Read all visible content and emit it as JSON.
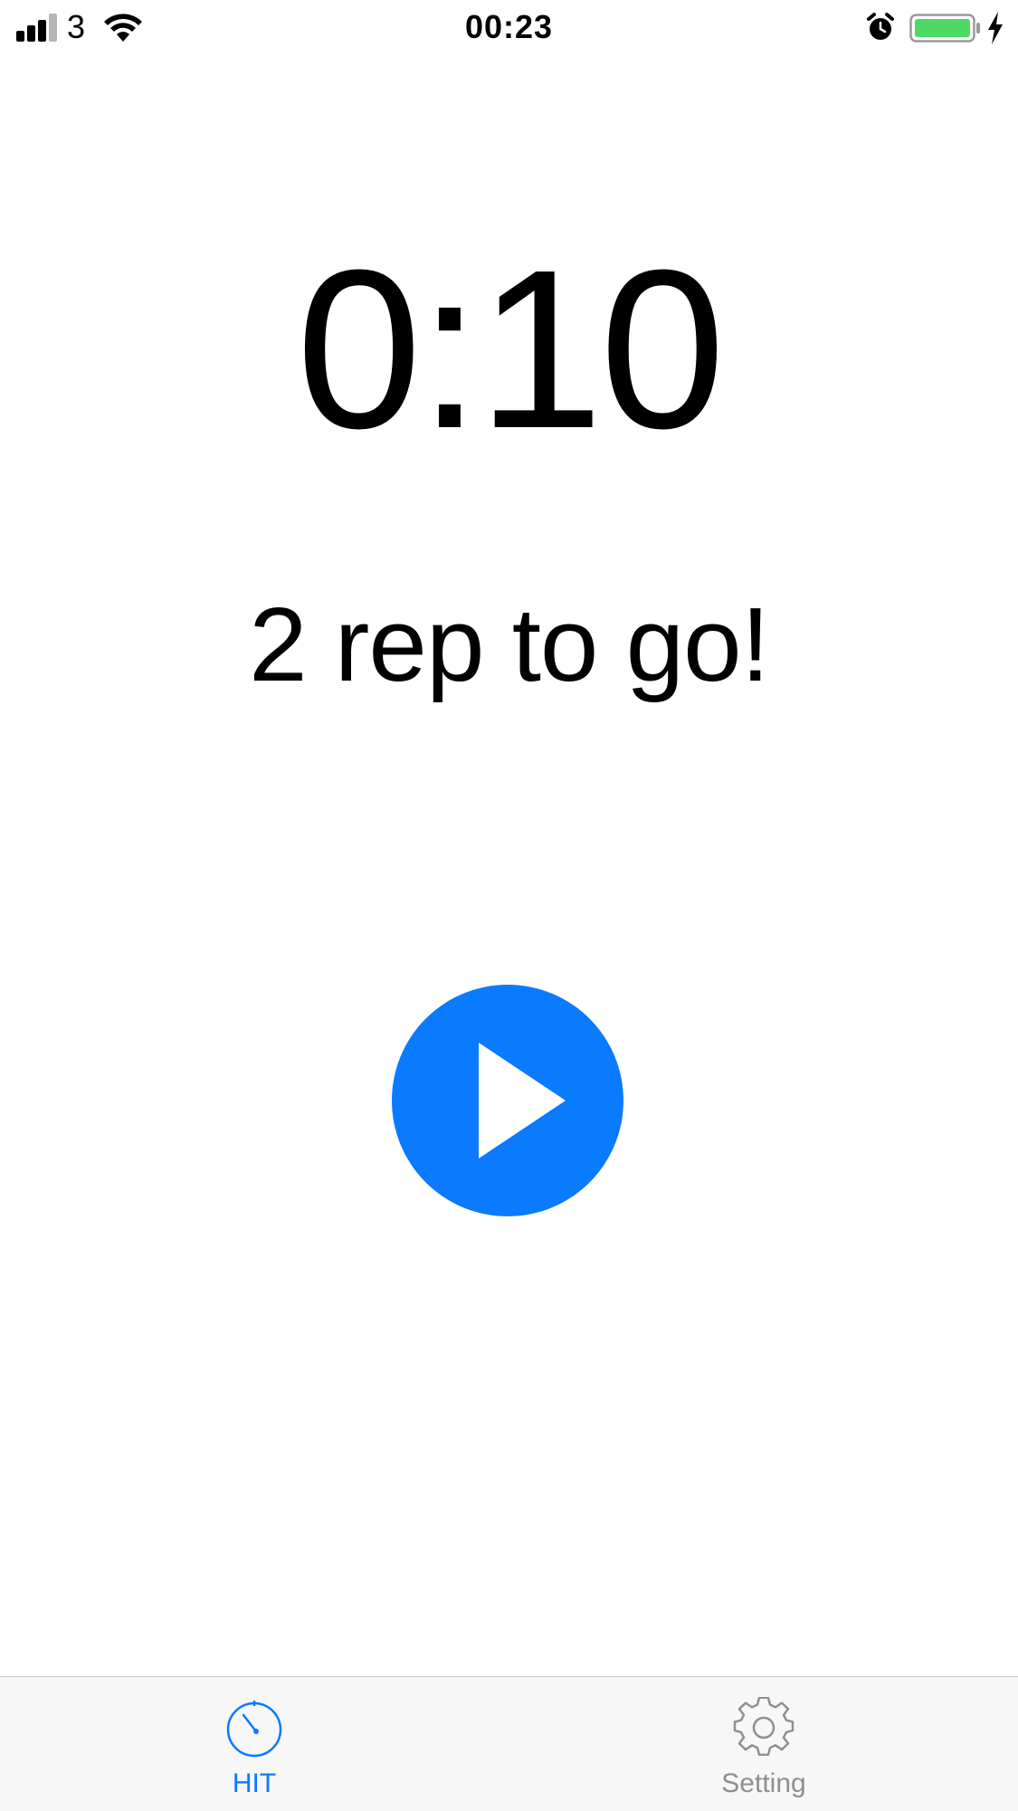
{
  "status_bar": {
    "carrier": "3",
    "time": "00:23",
    "signal_icon": "cellular-signal-icon",
    "wifi_icon": "wifi-icon",
    "alarm_icon": "alarm-clock-icon",
    "battery_icon": "battery-icon",
    "charging_icon": "charging-bolt-icon",
    "battery_color": "#4cd964"
  },
  "main": {
    "timer": "0:10",
    "reps_message": "2 rep to go!",
    "play_icon": "play-icon",
    "accent_color": "#0a7aff"
  },
  "tab_bar": {
    "tabs": [
      {
        "label": "HIT",
        "icon": "stopwatch-icon",
        "active": true
      },
      {
        "label": "Setting",
        "icon": "gear-icon",
        "active": false
      }
    ]
  }
}
